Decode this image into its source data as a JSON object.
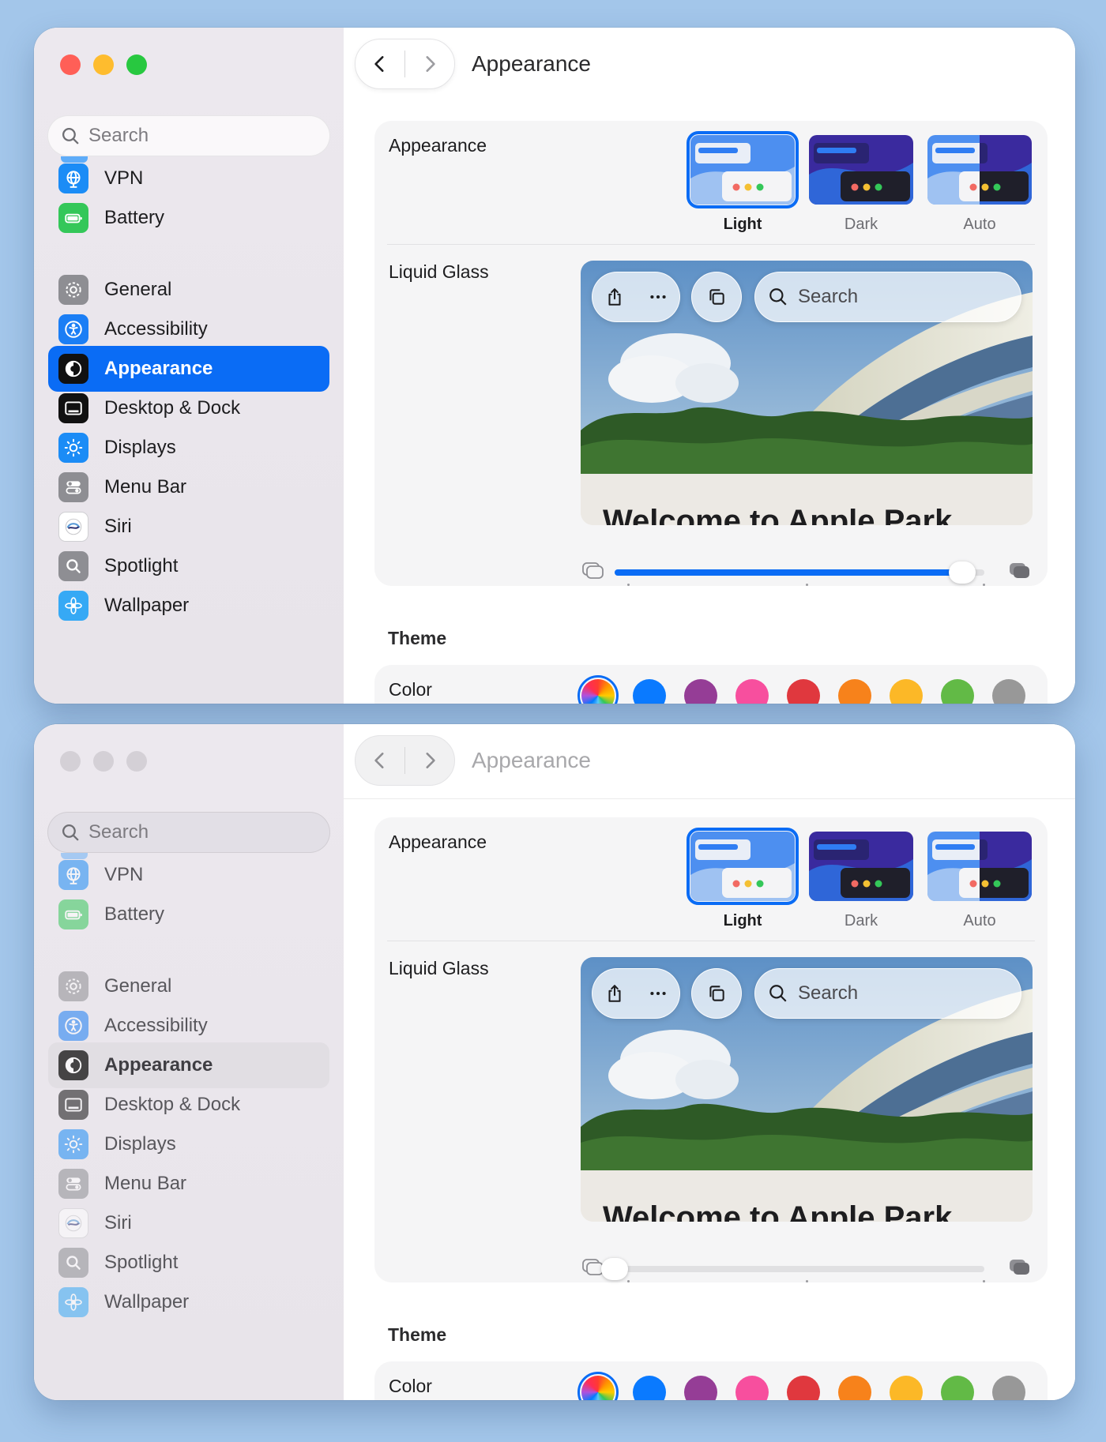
{
  "windows": [
    {
      "state": "active",
      "title": "Appearance",
      "slider_value": 0.94
    },
    {
      "state": "inactive",
      "title": "Appearance",
      "slider_value": 0.0
    }
  ],
  "sidebar": {
    "search_placeholder": "Search",
    "items": [
      {
        "label": "VPN",
        "icon": "globe-icon",
        "color": "#1b8cf6"
      },
      {
        "label": "Battery",
        "icon": "battery-icon",
        "color": "#34c759"
      },
      {
        "label": "General",
        "icon": "gear-icon",
        "color": "#8e8e93"
      },
      {
        "label": "Accessibility",
        "icon": "accessibility-icon",
        "color": "#1b7ef5"
      },
      {
        "label": "Appearance",
        "icon": "appearance-icon",
        "color": "#111111",
        "selected": true
      },
      {
        "label": "Desktop & Dock",
        "icon": "dock-icon",
        "color": "#111111"
      },
      {
        "label": "Displays",
        "icon": "sun-icon",
        "color": "#1b8cf6"
      },
      {
        "label": "Menu Bar",
        "icon": "toggle-icon",
        "color": "#8e8e93"
      },
      {
        "label": "Siri",
        "icon": "siri-icon",
        "color": "#ffffff"
      },
      {
        "label": "Spotlight",
        "icon": "magnifier-icon",
        "color": "#8e8e93"
      },
      {
        "label": "Wallpaper",
        "icon": "flower-icon",
        "color": "#36a9f5"
      }
    ]
  },
  "appearance": {
    "label": "Appearance",
    "options": [
      {
        "label": "Light",
        "selected": true
      },
      {
        "label": "Dark",
        "selected": false
      },
      {
        "label": "Auto",
        "selected": false
      }
    ]
  },
  "liquid_glass": {
    "label": "Liquid Glass",
    "search_label": "Search",
    "welcome_text": "Welcome to Apple Park"
  },
  "theme": {
    "heading": "Theme",
    "color_label": "Color",
    "colors": [
      "multicolor",
      "#0a7aff",
      "#953d96",
      "#f74f9e",
      "#e0383e",
      "#f7821b",
      "#fcb827",
      "#62ba46",
      "#989898"
    ]
  },
  "accent": "#0a6cf5"
}
